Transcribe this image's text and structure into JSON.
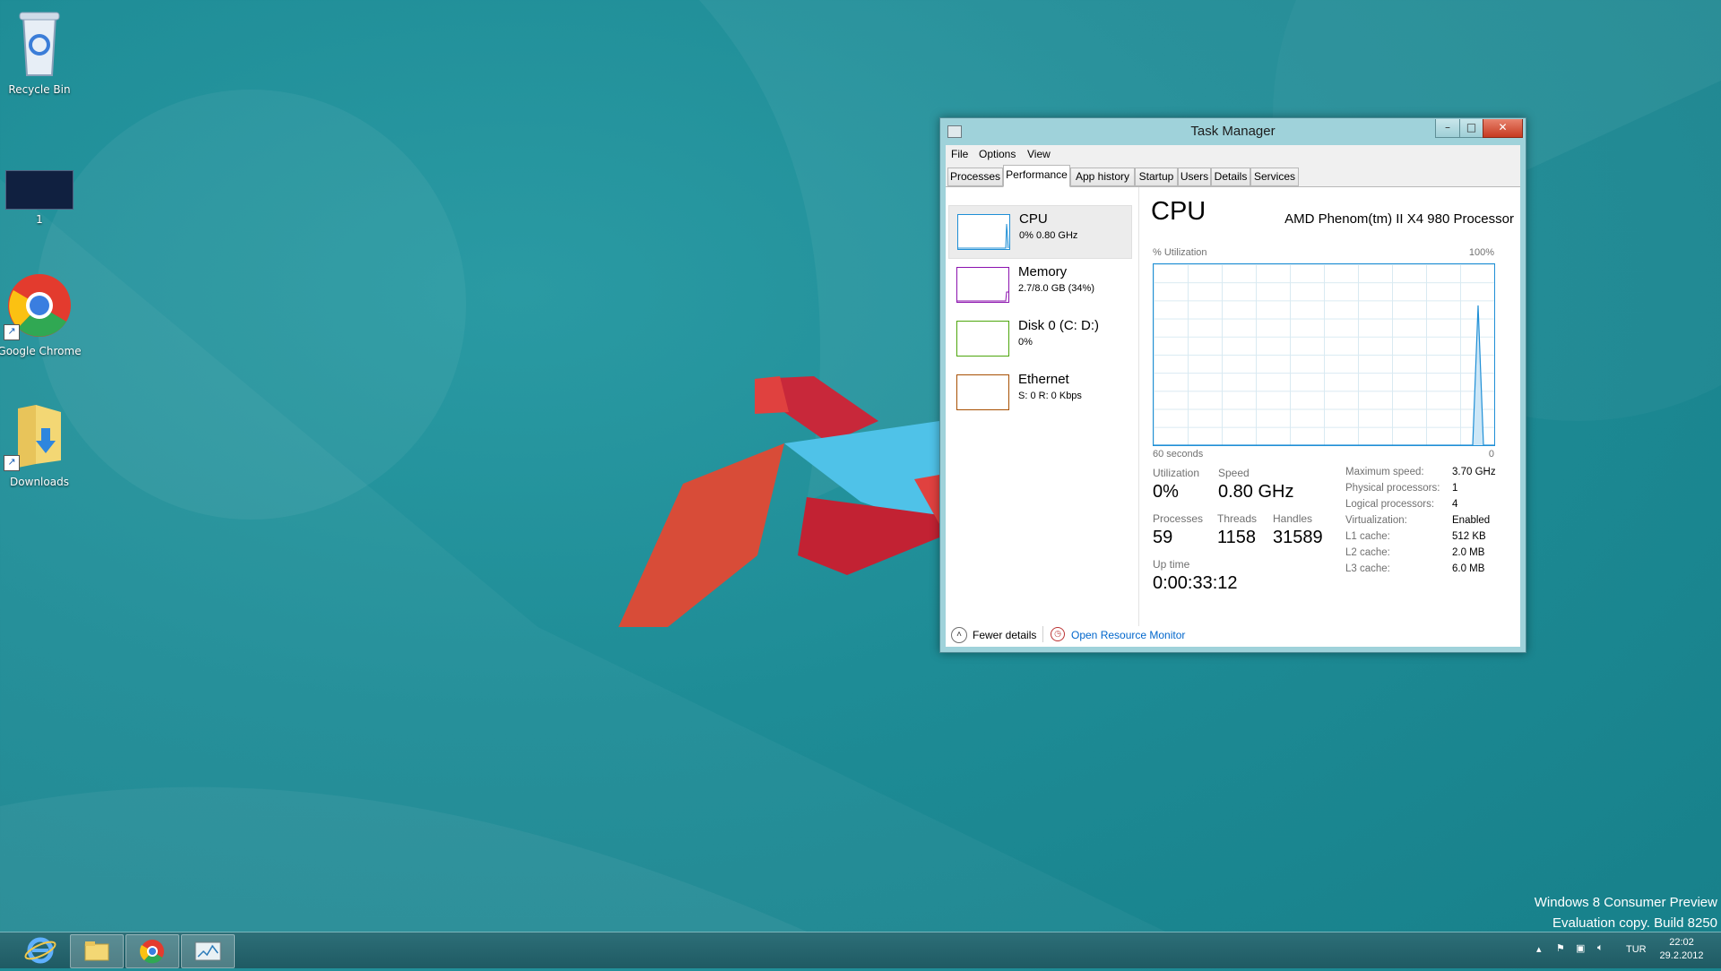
{
  "desktop": {
    "icons": [
      {
        "label": "Recycle Bin"
      },
      {
        "label": "1"
      },
      {
        "label": "Google Chrome"
      },
      {
        "label": "Downloads"
      }
    ],
    "watermark": {
      "line1": "Windows 8 Consumer Preview",
      "line2": "Evaluation copy. Build 8250"
    }
  },
  "taskbar": {
    "buttons": [
      {
        "icon": "internet-explorer-icon"
      },
      {
        "icon": "file-explorer-icon"
      },
      {
        "icon": "google-chrome-icon"
      },
      {
        "icon": "task-manager-icon"
      }
    ],
    "tray": {
      "language": "TUR",
      "time": "22:02",
      "date": "29.2.2012"
    }
  },
  "task_manager": {
    "title": "Task Manager",
    "menu": [
      "File",
      "Options",
      "View"
    ],
    "tabs": [
      "Processes",
      "Performance",
      "App history",
      "Startup",
      "Users",
      "Details",
      "Services"
    ],
    "active_tab": "Performance",
    "resources": [
      {
        "name": "CPU",
        "detail": "0%  0.80 GHz",
        "color": "#1f8fd6"
      },
      {
        "name": "Memory",
        "detail": "2.7/8.0 GB (34%)",
        "color": "#8b12ae"
      },
      {
        "name": "Disk 0 (C: D:)",
        "detail": "0%",
        "color": "#4da60c"
      },
      {
        "name": "Ethernet",
        "detail": "S: 0  R: 0 Kbps",
        "color": "#a74f01"
      }
    ],
    "detail": {
      "heading": "CPU",
      "model": "AMD Phenom(tm) II X4 980 Processor",
      "utilization_label": "% Utilization",
      "max_label": "100%",
      "time_label": "60 seconds",
      "zero_label": "0",
      "stats": {
        "utilization_label": "Utilization",
        "utilization": "0%",
        "speed_label": "Speed",
        "speed": "0.80 GHz",
        "processes_label": "Processes",
        "processes": "59",
        "threads_label": "Threads",
        "threads": "1158",
        "handles_label": "Handles",
        "handles": "31589",
        "uptime_label": "Up time",
        "uptime": "0:00:33:12"
      },
      "specs": [
        {
          "label": "Maximum speed:",
          "value": "3.70 GHz"
        },
        {
          "label": "Physical processors:",
          "value": "1"
        },
        {
          "label": "Logical processors:",
          "value": "4"
        },
        {
          "label": "Virtualization:",
          "value": "Enabled"
        },
        {
          "label": "L1 cache:",
          "value": "512 KB"
        },
        {
          "label": "L2 cache:",
          "value": "2.0 MB"
        },
        {
          "label": "L3 cache:",
          "value": "6.0 MB"
        }
      ]
    },
    "footer": {
      "fewer_details": "Fewer details",
      "open_resource_monitor": "Open Resource Monitor"
    },
    "colors": {
      "graph": "#1f8fd6",
      "link": "#0066cc"
    }
  }
}
